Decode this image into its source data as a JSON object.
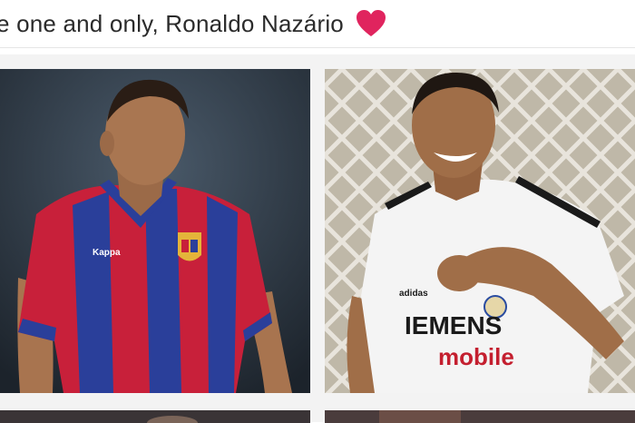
{
  "post": {
    "caption": "e one and only, Ronaldo Nazário",
    "heart_icon": "red-heart-emoji",
    "heart_color": "#e0245e"
  },
  "photos": [
    {
      "role": "barcelona-portrait",
      "jersey_brand": "Kappa",
      "colors": {
        "blue": "#2a3f9a",
        "red": "#c8203a",
        "crest": "#e4b43a"
      }
    },
    {
      "role": "real-madrid-celebration",
      "sponsor_top": "IEMENS",
      "sponsor_bottom": "mobile",
      "brand": "adidas",
      "colors": {
        "shirt": "#f4f4f4",
        "sponsor": "#1a1a1a",
        "mobile": "#c41f2f"
      }
    },
    {
      "role": "bottom-left-partial"
    },
    {
      "role": "bottom-right-partial"
    }
  ]
}
